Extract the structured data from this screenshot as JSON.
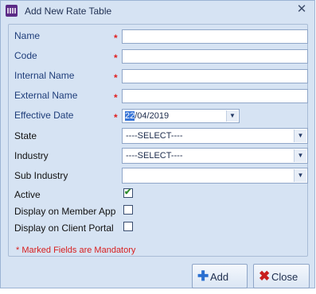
{
  "window": {
    "title": "Add New Rate Table"
  },
  "fields": {
    "name_label": "Name",
    "code_label": "Code",
    "internal_name_label": "Internal Name",
    "external_name_label": "External Name",
    "effective_date_label": "Effective Date",
    "effective_date_value_day": "22",
    "effective_date_value_rest": "/04/2019",
    "state_label": "State",
    "state_value": "----SELECT----",
    "industry_label": "Industry",
    "industry_value": "----SELECT----",
    "sub_industry_label": "Sub Industry",
    "sub_industry_value": "",
    "active_label": "Active",
    "active_checked": true,
    "member_app_label": "Display on Member App",
    "member_app_checked": false,
    "client_portal_label": "Display on Client Portal",
    "client_portal_checked": false,
    "required_marker": "*"
  },
  "footer": {
    "mandatory_note": "* Marked Fields are Mandatory",
    "add_label": "Add",
    "close_label": "Close"
  },
  "colors": {
    "required": "#e02020",
    "add_icon": "#2a6fd0",
    "close_icon": "#c81e1e"
  }
}
